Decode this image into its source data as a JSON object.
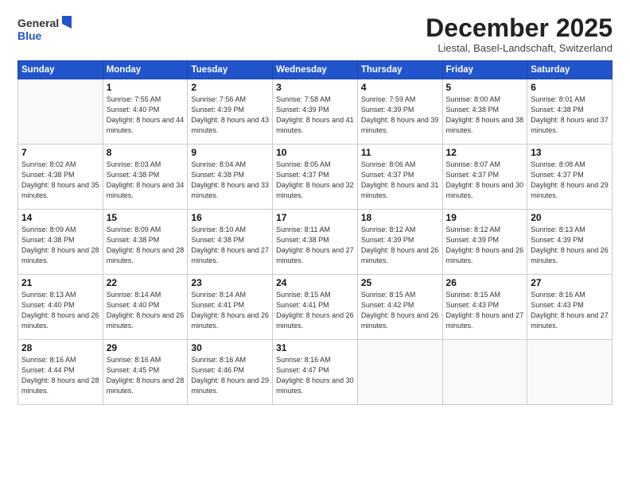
{
  "logo": {
    "general": "General",
    "blue": "Blue"
  },
  "title": "December 2025",
  "location": "Liestal, Basel-Landschaft, Switzerland",
  "days_of_week": [
    "Sunday",
    "Monday",
    "Tuesday",
    "Wednesday",
    "Thursday",
    "Friday",
    "Saturday"
  ],
  "weeks": [
    [
      {
        "day": "",
        "sunrise": "",
        "sunset": "",
        "daylight": ""
      },
      {
        "day": "1",
        "sunrise": "Sunrise: 7:55 AM",
        "sunset": "Sunset: 4:40 PM",
        "daylight": "Daylight: 8 hours and 44 minutes."
      },
      {
        "day": "2",
        "sunrise": "Sunrise: 7:56 AM",
        "sunset": "Sunset: 4:39 PM",
        "daylight": "Daylight: 8 hours and 43 minutes."
      },
      {
        "day": "3",
        "sunrise": "Sunrise: 7:58 AM",
        "sunset": "Sunset: 4:39 PM",
        "daylight": "Daylight: 8 hours and 41 minutes."
      },
      {
        "day": "4",
        "sunrise": "Sunrise: 7:59 AM",
        "sunset": "Sunset: 4:39 PM",
        "daylight": "Daylight: 8 hours and 39 minutes."
      },
      {
        "day": "5",
        "sunrise": "Sunrise: 8:00 AM",
        "sunset": "Sunset: 4:38 PM",
        "daylight": "Daylight: 8 hours and 38 minutes."
      },
      {
        "day": "6",
        "sunrise": "Sunrise: 8:01 AM",
        "sunset": "Sunset: 4:38 PM",
        "daylight": "Daylight: 8 hours and 37 minutes."
      }
    ],
    [
      {
        "day": "7",
        "sunrise": "Sunrise: 8:02 AM",
        "sunset": "Sunset: 4:38 PM",
        "daylight": "Daylight: 8 hours and 35 minutes."
      },
      {
        "day": "8",
        "sunrise": "Sunrise: 8:03 AM",
        "sunset": "Sunset: 4:38 PM",
        "daylight": "Daylight: 8 hours and 34 minutes."
      },
      {
        "day": "9",
        "sunrise": "Sunrise: 8:04 AM",
        "sunset": "Sunset: 4:38 PM",
        "daylight": "Daylight: 8 hours and 33 minutes."
      },
      {
        "day": "10",
        "sunrise": "Sunrise: 8:05 AM",
        "sunset": "Sunset: 4:37 PM",
        "daylight": "Daylight: 8 hours and 32 minutes."
      },
      {
        "day": "11",
        "sunrise": "Sunrise: 8:06 AM",
        "sunset": "Sunset: 4:37 PM",
        "daylight": "Daylight: 8 hours and 31 minutes."
      },
      {
        "day": "12",
        "sunrise": "Sunrise: 8:07 AM",
        "sunset": "Sunset: 4:37 PM",
        "daylight": "Daylight: 8 hours and 30 minutes."
      },
      {
        "day": "13",
        "sunrise": "Sunrise: 8:08 AM",
        "sunset": "Sunset: 4:37 PM",
        "daylight": "Daylight: 8 hours and 29 minutes."
      }
    ],
    [
      {
        "day": "14",
        "sunrise": "Sunrise: 8:09 AM",
        "sunset": "Sunset: 4:38 PM",
        "daylight": "Daylight: 8 hours and 28 minutes."
      },
      {
        "day": "15",
        "sunrise": "Sunrise: 8:09 AM",
        "sunset": "Sunset: 4:38 PM",
        "daylight": "Daylight: 8 hours and 28 minutes."
      },
      {
        "day": "16",
        "sunrise": "Sunrise: 8:10 AM",
        "sunset": "Sunset: 4:38 PM",
        "daylight": "Daylight: 8 hours and 27 minutes."
      },
      {
        "day": "17",
        "sunrise": "Sunrise: 8:11 AM",
        "sunset": "Sunset: 4:38 PM",
        "daylight": "Daylight: 8 hours and 27 minutes."
      },
      {
        "day": "18",
        "sunrise": "Sunrise: 8:12 AM",
        "sunset": "Sunset: 4:39 PM",
        "daylight": "Daylight: 8 hours and 26 minutes."
      },
      {
        "day": "19",
        "sunrise": "Sunrise: 8:12 AM",
        "sunset": "Sunset: 4:39 PM",
        "daylight": "Daylight: 8 hours and 26 minutes."
      },
      {
        "day": "20",
        "sunrise": "Sunrise: 8:13 AM",
        "sunset": "Sunset: 4:39 PM",
        "daylight": "Daylight: 8 hours and 26 minutes."
      }
    ],
    [
      {
        "day": "21",
        "sunrise": "Sunrise: 8:13 AM",
        "sunset": "Sunset: 4:40 PM",
        "daylight": "Daylight: 8 hours and 26 minutes."
      },
      {
        "day": "22",
        "sunrise": "Sunrise: 8:14 AM",
        "sunset": "Sunset: 4:40 PM",
        "daylight": "Daylight: 8 hours and 26 minutes."
      },
      {
        "day": "23",
        "sunrise": "Sunrise: 8:14 AM",
        "sunset": "Sunset: 4:41 PM",
        "daylight": "Daylight: 8 hours and 26 minutes."
      },
      {
        "day": "24",
        "sunrise": "Sunrise: 8:15 AM",
        "sunset": "Sunset: 4:41 PM",
        "daylight": "Daylight: 8 hours and 26 minutes."
      },
      {
        "day": "25",
        "sunrise": "Sunrise: 8:15 AM",
        "sunset": "Sunset: 4:42 PM",
        "daylight": "Daylight: 8 hours and 26 minutes."
      },
      {
        "day": "26",
        "sunrise": "Sunrise: 8:15 AM",
        "sunset": "Sunset: 4:43 PM",
        "daylight": "Daylight: 8 hours and 27 minutes."
      },
      {
        "day": "27",
        "sunrise": "Sunrise: 8:16 AM",
        "sunset": "Sunset: 4:43 PM",
        "daylight": "Daylight: 8 hours and 27 minutes."
      }
    ],
    [
      {
        "day": "28",
        "sunrise": "Sunrise: 8:16 AM",
        "sunset": "Sunset: 4:44 PM",
        "daylight": "Daylight: 8 hours and 28 minutes."
      },
      {
        "day": "29",
        "sunrise": "Sunrise: 8:16 AM",
        "sunset": "Sunset: 4:45 PM",
        "daylight": "Daylight: 8 hours and 28 minutes."
      },
      {
        "day": "30",
        "sunrise": "Sunrise: 8:16 AM",
        "sunset": "Sunset: 4:46 PM",
        "daylight": "Daylight: 8 hours and 29 minutes."
      },
      {
        "day": "31",
        "sunrise": "Sunrise: 8:16 AM",
        "sunset": "Sunset: 4:47 PM",
        "daylight": "Daylight: 8 hours and 30 minutes."
      },
      {
        "day": "",
        "sunrise": "",
        "sunset": "",
        "daylight": ""
      },
      {
        "day": "",
        "sunrise": "",
        "sunset": "",
        "daylight": ""
      },
      {
        "day": "",
        "sunrise": "",
        "sunset": "",
        "daylight": ""
      }
    ]
  ]
}
